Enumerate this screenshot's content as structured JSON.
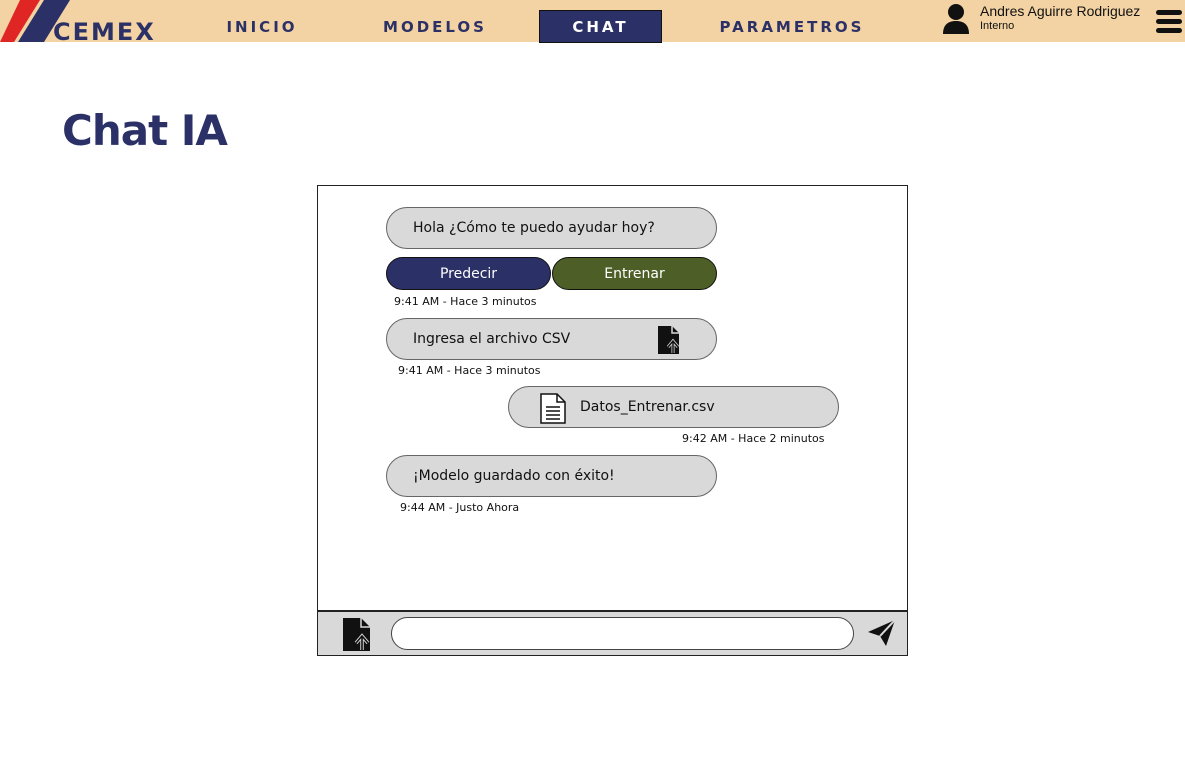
{
  "header": {
    "logo_text": "CEMEX",
    "nav": [
      {
        "label": "INICIO"
      },
      {
        "label": "MODELOS"
      },
      {
        "label": "CHAT"
      },
      {
        "label": "PARAMETROS"
      }
    ],
    "active_tab": "CHAT",
    "user": {
      "name": "Andres Aguirre Rodriguez",
      "role": "Interno",
      "icon": "user-icon"
    },
    "menu_icon": "hamburger-menu-icon"
  },
  "page": {
    "title": "Chat IA"
  },
  "chat": {
    "greeting": "Hola ¿Cómo te puedo ayudar hoy?",
    "actions": {
      "predict_label": "Predecir",
      "train_label": "Entrenar"
    },
    "greeting_time": "9:41 AM - Hace 3 minutos",
    "csv_prompt": "Ingresa el archivo CSV",
    "csv_prompt_time": "9:41 AM - Hace 3 minutos",
    "uploaded_file": "Datos_Entrenar.csv",
    "uploaded_file_time": "9:42 AM - Hace 2 minutos",
    "success": "¡Modelo guardado con éxito!",
    "success_time": "9:44 AM - Justo Ahora"
  },
  "composer": {
    "input_value": "",
    "upload_icon": "file-upload-icon",
    "send_icon": "send-icon"
  },
  "colors": {
    "header_bg": "#f3d3a3",
    "navy": "#2b3067",
    "green": "#4d5e26",
    "bubble": "#d9d9d9",
    "logo_red": "#e02525"
  }
}
